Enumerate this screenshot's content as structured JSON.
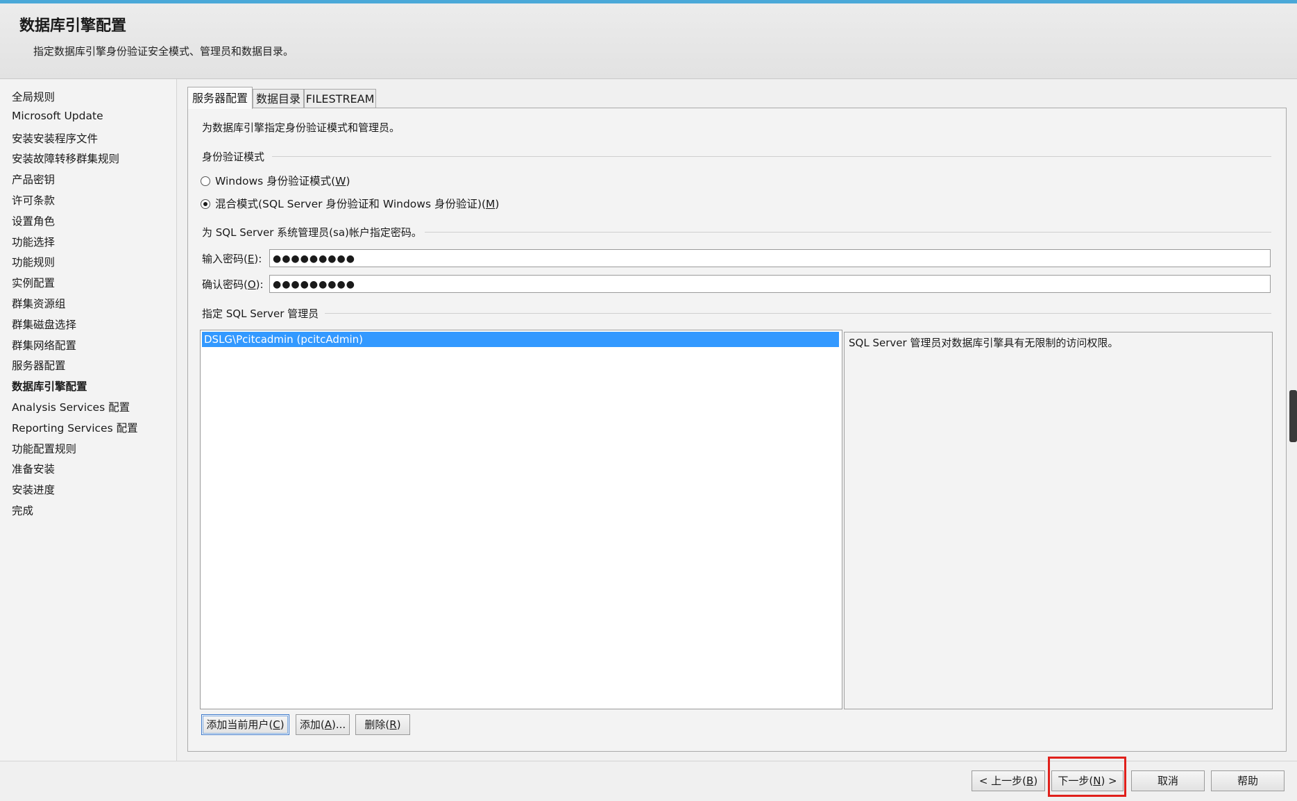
{
  "header": {
    "title": "数据库引擎配置",
    "description": "指定数据库引擎身份验证安全模式、管理员和数据目录。"
  },
  "sidebar": {
    "items": [
      "全局规则",
      "Microsoft Update",
      "安装安装程序文件",
      "安装故障转移群集规则",
      "产品密钥",
      "许可条款",
      "设置角色",
      "功能选择",
      "功能规则",
      "实例配置",
      "群集资源组",
      "群集磁盘选择",
      "群集网络配置",
      "服务器配置",
      "数据库引擎配置",
      "Analysis Services 配置",
      "Reporting Services 配置",
      "功能配置规则",
      "准备安装",
      "安装进度",
      "完成"
    ],
    "active_index": 14
  },
  "tabs": [
    {
      "label": "服务器配置",
      "active": true
    },
    {
      "label": "数据目录",
      "active": false
    },
    {
      "label": "FILESTREAM",
      "active": false
    }
  ],
  "panel": {
    "intro": "为数据库引擎指定身份验证模式和管理员。",
    "auth_group": "身份验证模式",
    "windows_mode": {
      "label": "Windows 身份验证模式(",
      "key": "W",
      "suffix": ")",
      "selected": false
    },
    "mixed_mode": {
      "label": "混合模式(SQL Server 身份验证和 Windows 身份验证)(",
      "key": "M",
      "suffix": ")",
      "selected": true
    },
    "sa_group": "为 SQL Server 系统管理员(sa)帐户指定密码。",
    "enter_password": {
      "label": "输入密码(",
      "key": "E",
      "suffix": "):",
      "value": "●●●●●●●●●"
    },
    "confirm_password": {
      "label": "确认密码(",
      "key": "O",
      "suffix": "):",
      "value": "●●●●●●●●●"
    },
    "admins_group": "指定 SQL Server 管理员",
    "admins": [
      "DSLG\\Pcitcadmin (pcitcAdmin)"
    ],
    "admins_info": "SQL Server 管理员对数据库引擎具有无限制的访问权限。",
    "add_current_user": {
      "label": "添加当前用户(",
      "key": "C",
      "suffix": ")"
    },
    "add": {
      "label": "添加(",
      "key": "A",
      "suffix": ")..."
    },
    "remove": {
      "label": "删除(",
      "key": "R",
      "suffix": ")"
    }
  },
  "footer": {
    "back": {
      "label": "< 上一步(",
      "key": "B",
      "suffix": ")"
    },
    "next": {
      "label": "下一步(",
      "key": "N",
      "suffix": ") >"
    },
    "cancel": "取消",
    "help": "帮助"
  },
  "colors": {
    "accent": "#3399ff",
    "highlight": "#e0201b",
    "topline": "#4aa8d8"
  }
}
